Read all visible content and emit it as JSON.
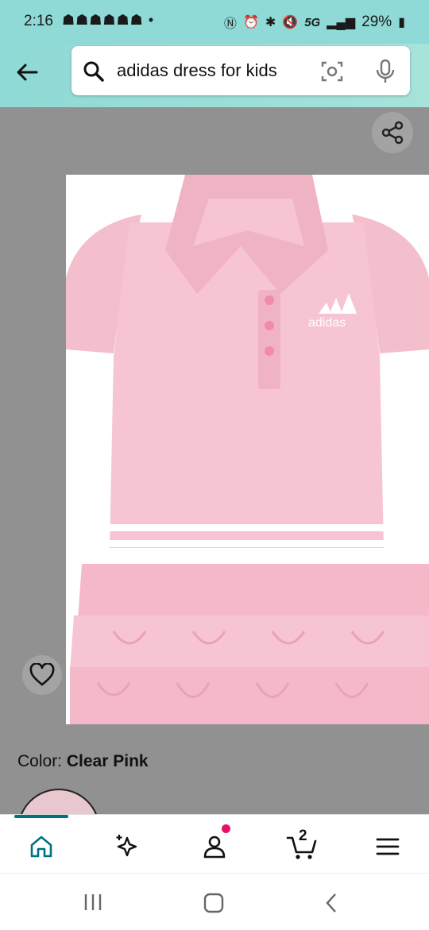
{
  "status": {
    "time": "2:16",
    "notification_icons": "☗☗☗☗☗☗ •",
    "network": "5G",
    "battery": "29%"
  },
  "search": {
    "query": "adidas dress for kids"
  },
  "product": {
    "brand_mark": "adidas",
    "color_label": "Color:",
    "color_value": "Clear Pink"
  },
  "nav": {
    "cart_count": "2",
    "active_tab": "home",
    "accent_color": "#007185"
  },
  "colors": {
    "header_bg": "#8fd9d6",
    "dress_pink": "#f6c4d2",
    "badge": "#e6106b"
  }
}
